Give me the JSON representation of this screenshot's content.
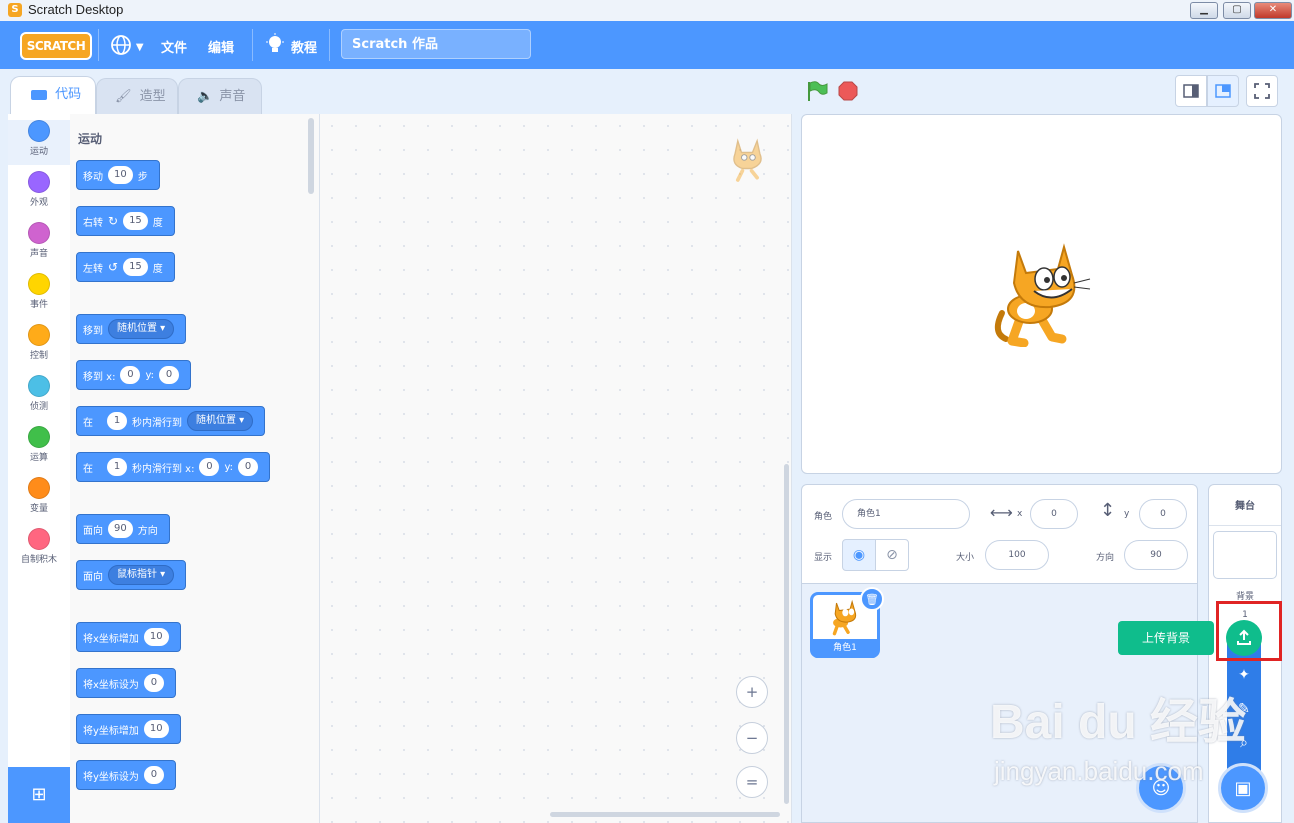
{
  "window": {
    "title": "Scratch Desktop",
    "min": "▁",
    "max": "▢",
    "close": "✕"
  },
  "menubar": {
    "logo": "SCRATCH",
    "language_icon": "globe-icon",
    "file": "文件",
    "edit": "编辑",
    "tutorials": "教程",
    "project_title": "Scratch 作品"
  },
  "tabs": {
    "code": "代码",
    "costumes": "造型",
    "sounds": "声音"
  },
  "categories": [
    {
      "label": "运动",
      "color": "#4c97ff"
    },
    {
      "label": "外观",
      "color": "#9966ff"
    },
    {
      "label": "声音",
      "color": "#cf63cf"
    },
    {
      "label": "事件",
      "color": "#ffd500"
    },
    {
      "label": "控制",
      "color": "#ffab19"
    },
    {
      "label": "侦测",
      "color": "#4cbfe6"
    },
    {
      "label": "运算",
      "color": "#40bf4a"
    },
    {
      "label": "变量",
      "color": "#ff8c1a"
    },
    {
      "label": "自制积木",
      "color": "#ff6680"
    }
  ],
  "palette": {
    "title": "运动",
    "move": {
      "a": "移动",
      "v": "10",
      "b": "步"
    },
    "turn_right": {
      "a": "右转",
      "v": "15",
      "b": "度"
    },
    "turn_left": {
      "a": "左转",
      "v": "15",
      "b": "度"
    },
    "goto": {
      "a": "移到",
      "d": "随机位置 ▾"
    },
    "goto_xy": {
      "a": "移到 x:",
      "x": "0",
      "b": "y:",
      "y": "0"
    },
    "glide": {
      "a": "在",
      "v": "1",
      "b": "秒内滑行到",
      "d": "随机位置 ▾"
    },
    "glide_xy": {
      "a": "在",
      "v": "1",
      "b": "秒内滑行到 x:",
      "x": "0",
      "c": "y:",
      "y": "0"
    },
    "point_dir": {
      "a": "面向",
      "v": "90",
      "b": "方向"
    },
    "point_towards": {
      "a": "面向",
      "d": "鼠标指针 ▾"
    },
    "change_x": {
      "a": "将x坐标增加",
      "v": "10"
    },
    "set_x": {
      "a": "将x坐标设为",
      "v": "0"
    },
    "change_y": {
      "a": "将y坐标增加",
      "v": "10"
    },
    "set_y": {
      "a": "将y坐标设为",
      "v": "0"
    }
  },
  "zoom": {
    "in": "+",
    "out": "−",
    "reset": "="
  },
  "sprite_info": {
    "sprite_label": "角色",
    "sprite_name": "角色1",
    "x_label": "x",
    "x": "0",
    "y_label": "y",
    "y": "0",
    "show_label": "显示",
    "size_label": "大小",
    "size": "100",
    "direction_label": "方向",
    "direction": "90"
  },
  "sprites": [
    {
      "name": "角色1"
    }
  ],
  "stage_pane": {
    "title": "舞台",
    "backdrop_label": "背景",
    "backdrop_count": "1"
  },
  "backdrop_menu": {
    "upload_tooltip": "上传背景"
  },
  "watermark": {
    "text": "Bai du 经验",
    "url": "jingyan.baidu.com"
  }
}
